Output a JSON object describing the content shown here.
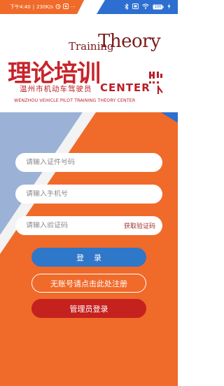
{
  "status_bar": {
    "time": "下午4:40",
    "speed": "230K/s",
    "more": "···",
    "battery": "100",
    "left_icons": [
      "alarm-icon",
      "app-notification-icon"
    ],
    "right_icons": [
      "bluetooth-icon",
      "screen-icon",
      "wifi-icon",
      "battery-icon",
      "charging-icon"
    ]
  },
  "logo": {
    "training": "Training",
    "theory": "Theory",
    "chinese_main": "理论培训",
    "chinese_sub": "温州市机动车驾驶员",
    "center": "CENTER",
    "english_sub": "WENZHOU VEHICLE PILOT TRAINING THEORY CENTER"
  },
  "form": {
    "id_placeholder": "请输入证件号码",
    "phone_placeholder": "请输入手机号",
    "code_placeholder": "请输入验证码",
    "get_code_label": "获取验证码"
  },
  "buttons": {
    "login": "登录",
    "register": "无账号请点击此处注册",
    "admin_login": "管理员登录"
  },
  "colors": {
    "status_bar": "#2d6fd0",
    "orange": "#f06a2a",
    "light_blue": "#9bb2d6",
    "login_blue": "#2e77c9",
    "admin_red": "#c4211f",
    "logo_red": "#c8232b"
  }
}
